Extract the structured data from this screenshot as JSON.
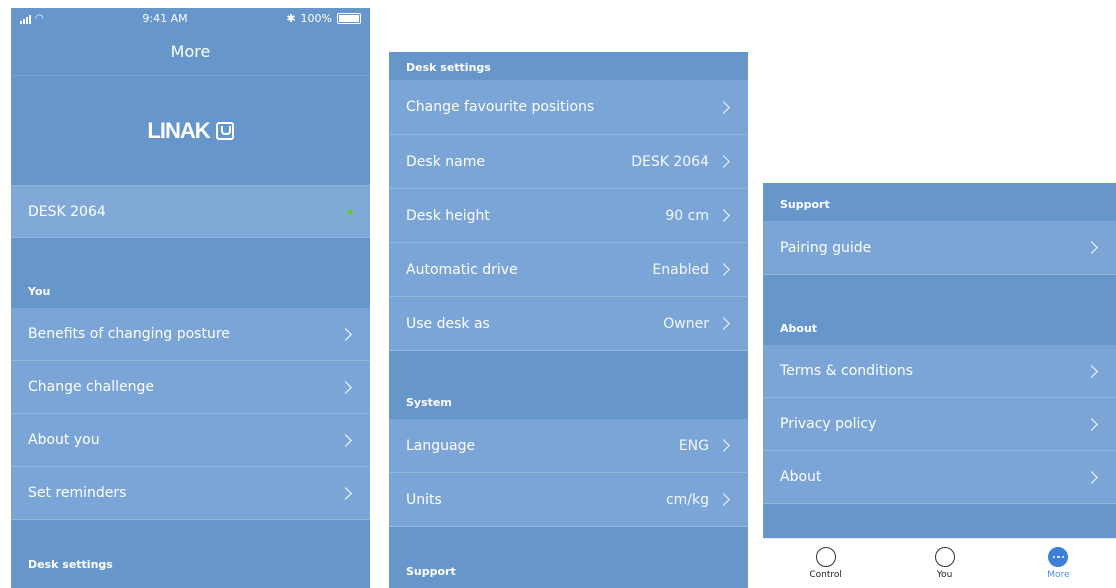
{
  "status": {
    "time": "9:41 AM",
    "battery": "100%",
    "bluetooth": "✱"
  },
  "nav": {
    "title": "More"
  },
  "logo": {
    "text": "LINAK"
  },
  "connected_desk": {
    "name": "DESK 2064",
    "status_color": "#6ac24a"
  },
  "sections": {
    "you": "You",
    "desk_settings": "Desk settings",
    "system": "System",
    "support": "Support",
    "about": "About"
  },
  "you_items": [
    "Benefits of changing posture",
    "Change challenge",
    "About you",
    "Set reminders"
  ],
  "desk_settings": [
    {
      "label": "Change favourite positions",
      "value": ""
    },
    {
      "label": "Desk name",
      "value": "DESK 2064"
    },
    {
      "label": "Desk height",
      "value": "90 cm"
    },
    {
      "label": "Automatic drive",
      "value": "Enabled"
    },
    {
      "label": "Use desk as",
      "value": "Owner"
    }
  ],
  "system": [
    {
      "label": "Language",
      "value": "ENG"
    },
    {
      "label": "Units",
      "value": "cm/kg"
    }
  ],
  "support_items": [
    "Pairing guide"
  ],
  "about_items": [
    "Terms & conditions",
    "Privacy policy",
    "About"
  ],
  "tabs": [
    {
      "label": "Control",
      "icon": "control-icon"
    },
    {
      "label": "You",
      "icon": "user-icon"
    },
    {
      "label": "More",
      "icon": "more-icon",
      "active": true
    }
  ],
  "colors": {
    "background": "#6796cb",
    "row": "#7aa5d6",
    "active_tab": "#4a90e2"
  }
}
